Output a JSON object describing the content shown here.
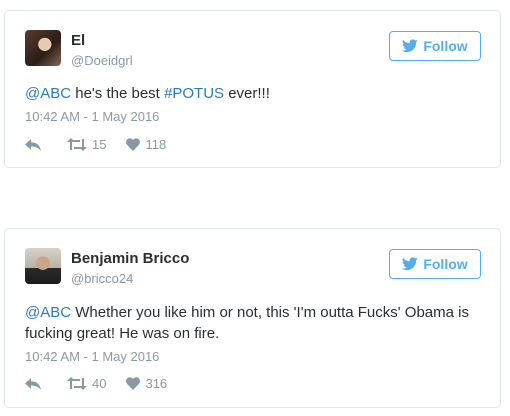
{
  "tweets": [
    {
      "name": "El",
      "handle": "@Doeidgrl",
      "follow_label": "Follow",
      "text_mention": "@ABC",
      "text_mid": " he's the best ",
      "text_hashtag": "#POTUS",
      "text_end": " ever!!!",
      "timestamp": "10:42 AM - 1 May 2016",
      "retweets": "15",
      "likes": "118"
    },
    {
      "name": "Benjamin Bricco",
      "handle": "@bricco24",
      "follow_label": "Follow",
      "text_mention": "@ABC",
      "text_rest": " Whether you like him or not, this 'I'm outta Fucks' Obama is fucking great! He was on fire.",
      "timestamp": "10:42 AM - 1 May 2016",
      "retweets": "40",
      "likes": "316"
    }
  ],
  "colors": {
    "accent": "#55acee",
    "link": "#2b7bb9",
    "muted": "#8899a6",
    "border": "#e1e8ed"
  },
  "icons": [
    "twitter-bird-icon",
    "reply-icon",
    "retweet-icon",
    "heart-icon"
  ]
}
